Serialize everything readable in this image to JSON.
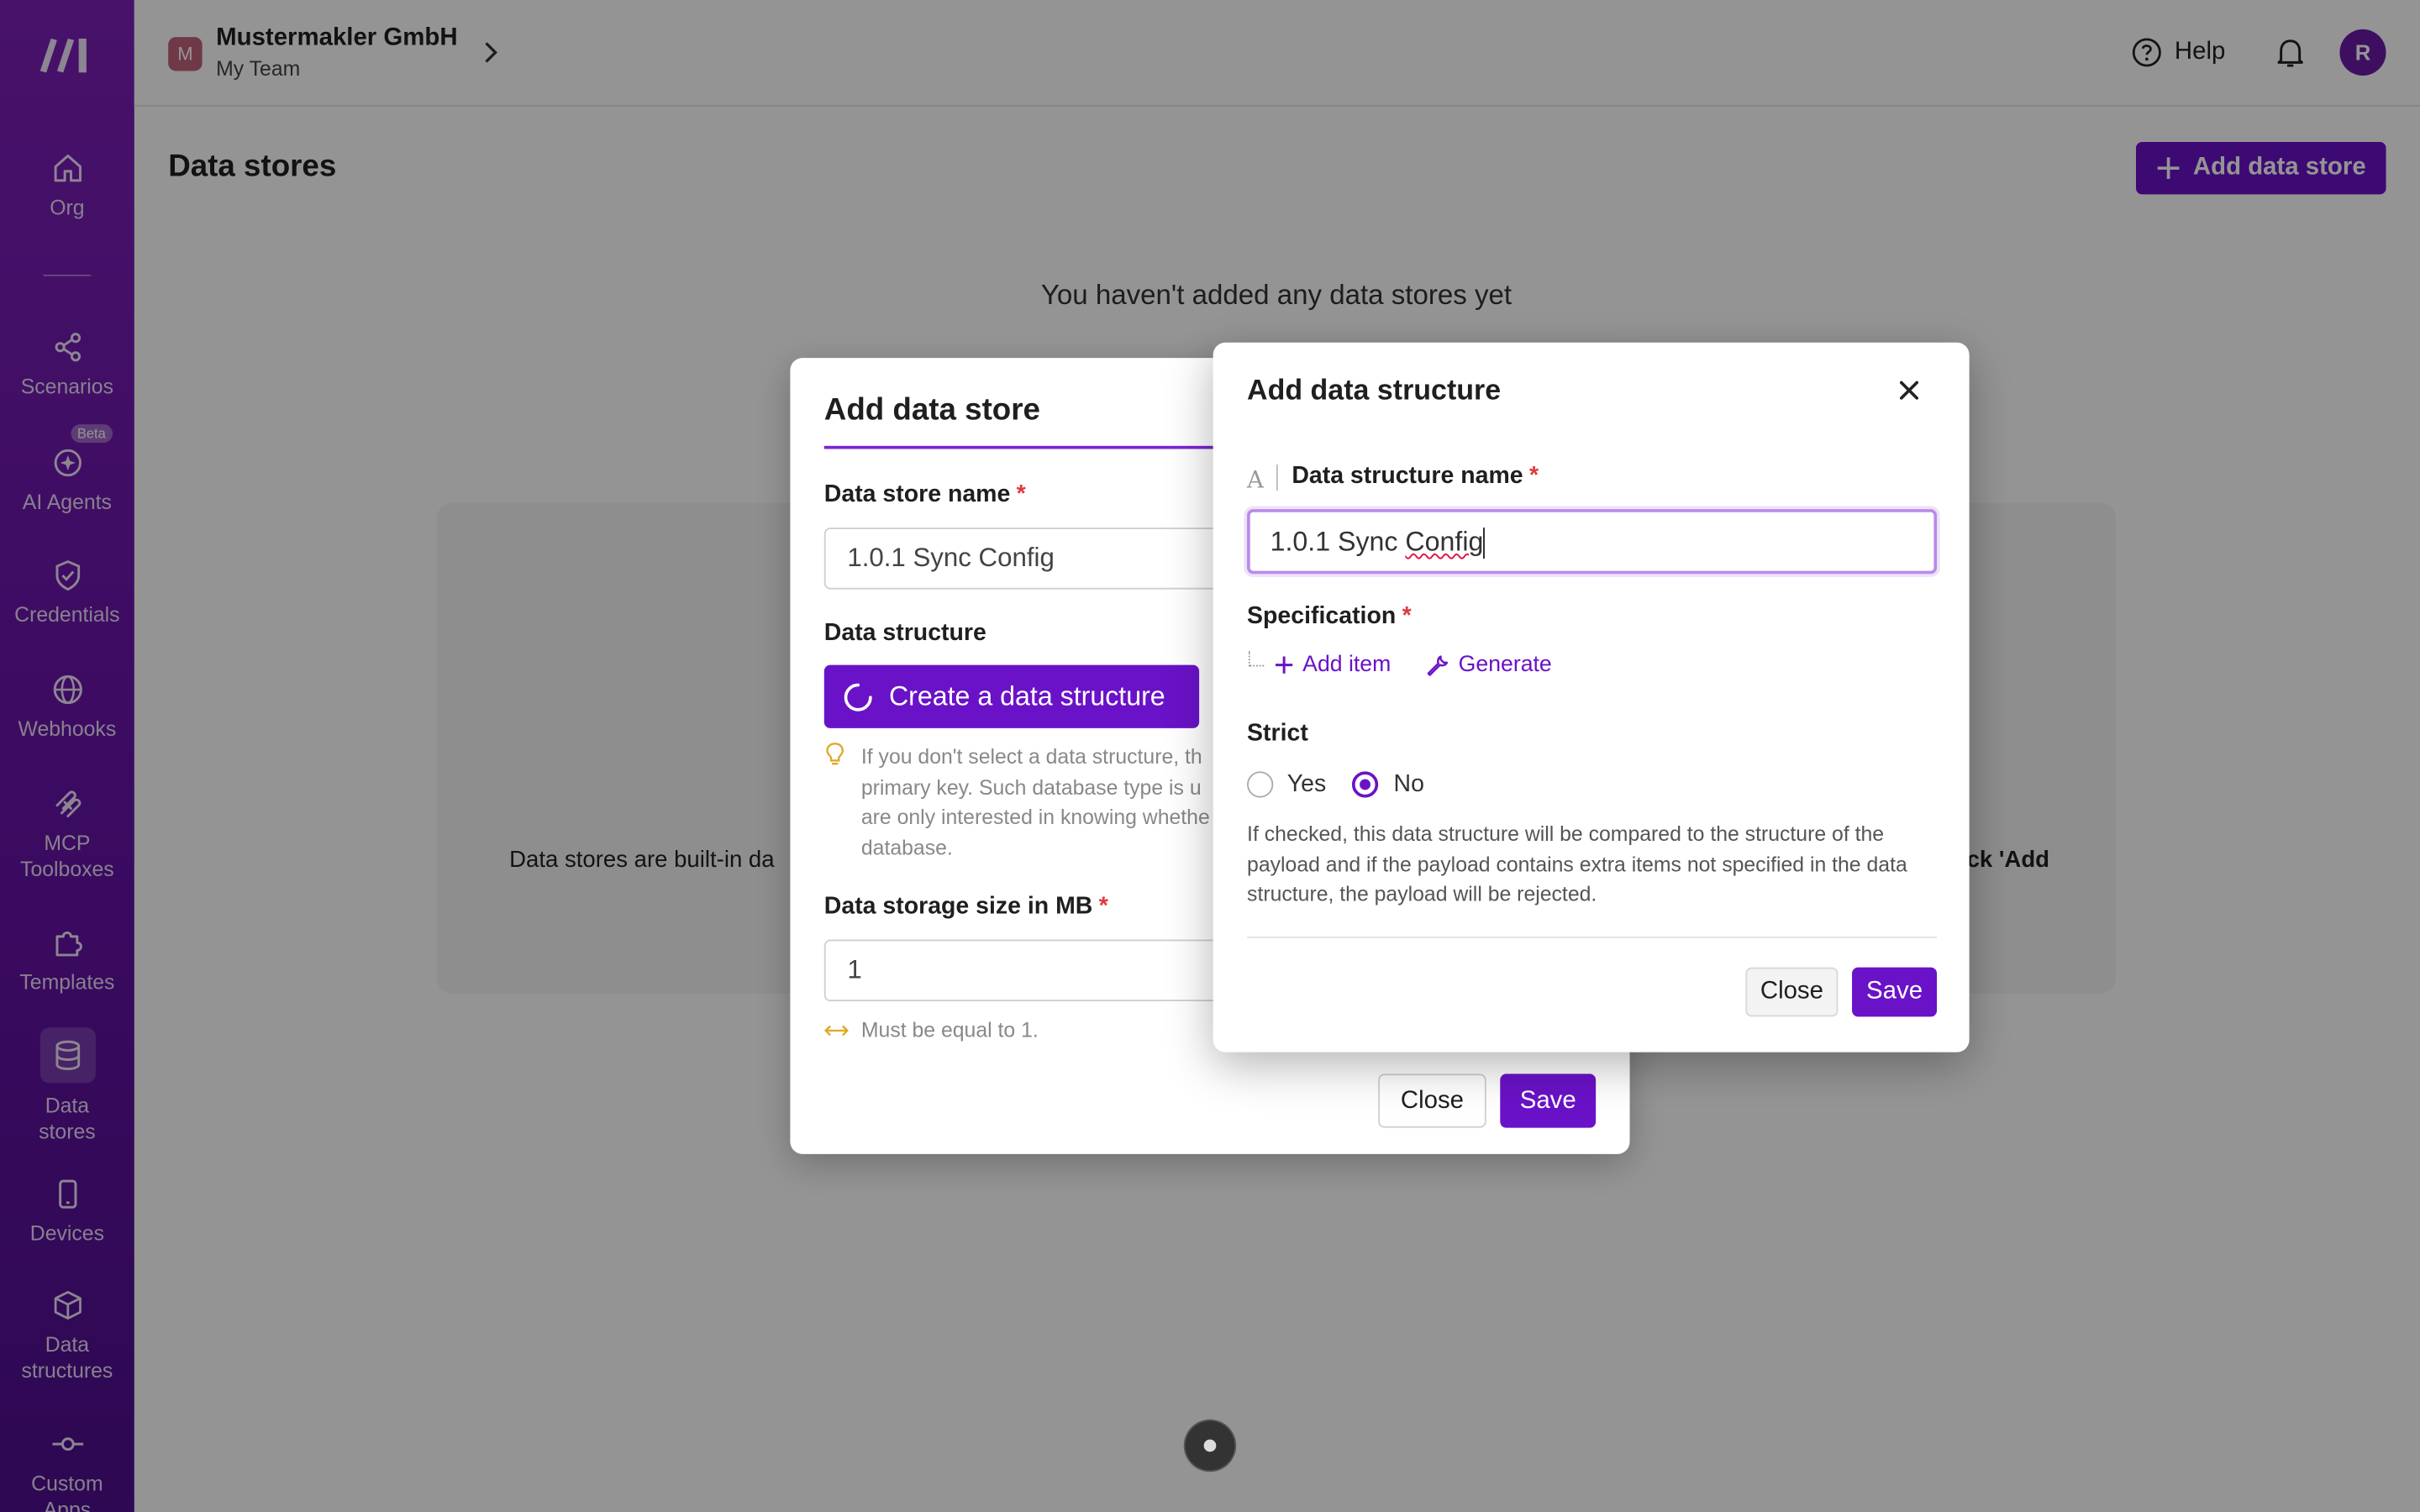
{
  "sidebar": {
    "items": [
      {
        "label": "Org",
        "icon": "home-icon"
      },
      {
        "label": "Scenarios",
        "icon": "share-nodes-icon"
      },
      {
        "label": "AI Agents",
        "icon": "sparkle-icon",
        "badge": "Beta"
      },
      {
        "label": "Credentials",
        "icon": "shield-check-icon"
      },
      {
        "label": "Webhooks",
        "icon": "globe-icon"
      },
      {
        "label": "MCP Toolboxes",
        "icon": "mcp-icon"
      },
      {
        "label": "Templates",
        "icon": "puzzle-icon"
      },
      {
        "label": "Data stores",
        "icon": "database-icon",
        "active": true
      },
      {
        "label": "Devices",
        "icon": "phone-icon"
      },
      {
        "label": "Data structures",
        "icon": "cube-icon"
      },
      {
        "label": "Custom Apps",
        "icon": "commit-icon"
      }
    ]
  },
  "topbar": {
    "team_badge": "M",
    "org_name": "Mustermakler GmbH",
    "team_name": "My Team",
    "help_label": "Help",
    "avatar_initial": "R"
  },
  "page": {
    "title": "Data stores",
    "add_button_label": "Add data store",
    "empty_title": "You haven't added any data stores yet",
    "empty_desc_left": "Data stores are built-in da",
    "empty_desc_right": "lick 'Add"
  },
  "add_data_store_dialog": {
    "title": "Add data store",
    "name_label": "Data store name",
    "name_value": "1.0.1 Sync Config",
    "structure_label": "Data structure",
    "create_button_label": "Create a data structure",
    "hint_lines": [
      "If you don't select a data structure, th",
      "primary key. Such database type is u",
      "are only interested in knowing whethe",
      "database."
    ],
    "size_label": "Data storage size in MB",
    "size_value": "1",
    "size_hint": "Must be equal to 1.",
    "close_label": "Close",
    "save_label": "Save"
  },
  "add_data_structure_dialog": {
    "title": "Add data structure",
    "type_icon_glyph": "A",
    "name_label": "Data structure name",
    "name_value_plain": "1.0.1 Sync ",
    "name_value_flagged": "Config",
    "spec_label": "Specification",
    "add_item_label": "Add item",
    "generate_label": "Generate",
    "strict_label": "Strict",
    "strict_options": [
      "Yes",
      "No"
    ],
    "strict_selected": "No",
    "strict_desc": "If checked, this data structure will be compared to the structure of the payload and if the payload contains extra items not specified in the data structure, the payload will be rejected.",
    "close_label": "Close",
    "save_label": "Save"
  },
  "colors": {
    "accent": "#6a12c8",
    "sidebar_top": "#7c1fb8",
    "required": "#e0393e"
  }
}
